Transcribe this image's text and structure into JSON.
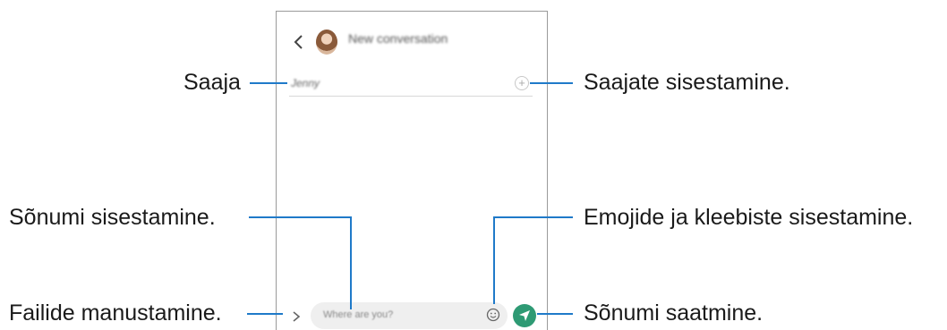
{
  "phone": {
    "conversation_title": "New conversation",
    "recipient_name": "Jenny",
    "message_placeholder": "Where are you?",
    "accent_color": "#2e9a74",
    "icons": [
      "back-icon",
      "avatar",
      "add-icon",
      "attach-icon",
      "emoji-icon",
      "send-icon"
    ]
  },
  "callouts": {
    "recipient": "Saaja",
    "add_recipients": "Saajate sisestamine.",
    "message_input": "Sõnumi sisestamine.",
    "emoji_stickers": "Emojide ja kleebiste sisestamine.",
    "attach_files": "Failide manustamine.",
    "send_message": "Sõnumi saatmine."
  },
  "leader_color": "#1f7ac9"
}
